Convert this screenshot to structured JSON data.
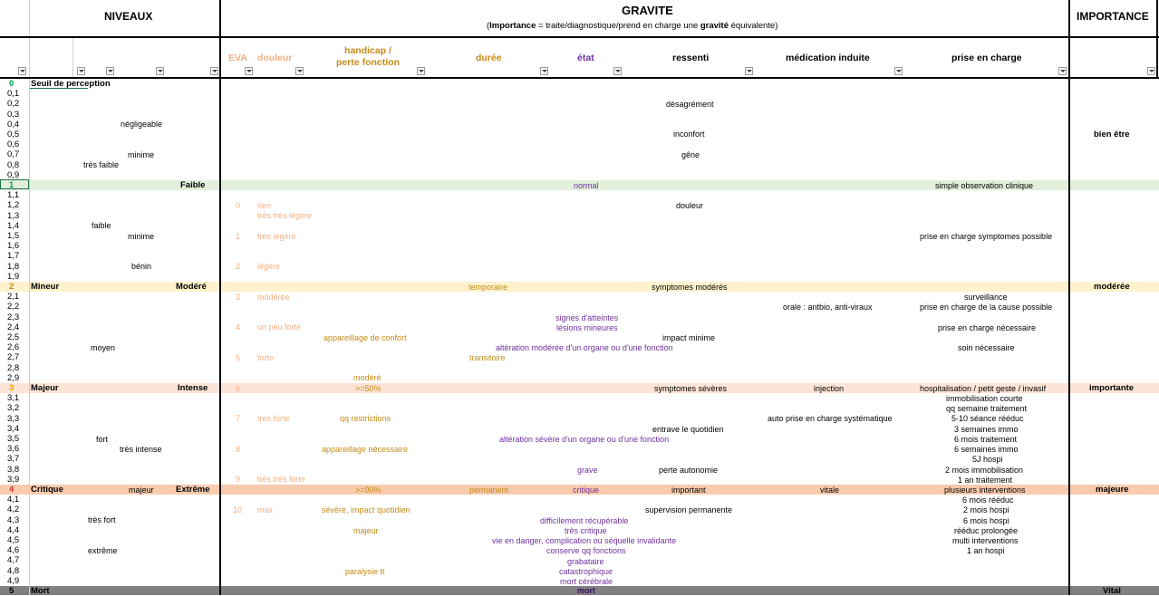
{
  "header": {
    "niveaux": "NIVEAUX",
    "gravite": "GRAVITE",
    "gravite_sub_open": "(",
    "gravite_sub_bold1": "Importance",
    "gravite_sub_mid": " = traite/diagnostique/prend en charge une ",
    "gravite_sub_bold2": "gravité",
    "gravite_sub_end": " équivalente)",
    "importance": "IMPORTANCE"
  },
  "columns": {
    "eva": "EVA",
    "douleur": "douleur",
    "handicap_1": "handicap /",
    "handicap_2": "perte fonction",
    "duree": "durée",
    "etat": "état",
    "ressenti": "ressenti",
    "medication": "médication induite",
    "prise": "prise en charge"
  },
  "colors": {
    "band_green": "#e2efda",
    "band_yellow": "#fff2cc",
    "band_orange": "#fce4d6",
    "band_red": "#f8cbad",
    "band_gray": "#808080",
    "orange": "#f4b183",
    "gold": "#c58b17",
    "purple": "#7030a0"
  },
  "row_labels": [
    "0",
    "0,1",
    "0,2",
    "0,3",
    "0,4",
    "0,5",
    "0,6",
    "0,7",
    "0,8",
    "0,9",
    "1",
    "1,1",
    "1,2",
    "1,3",
    "1,4",
    "1,5",
    "1,6",
    "1,7",
    "1,8",
    "1,9",
    "2",
    "2,1",
    "2,2",
    "2,3",
    "2,4",
    "2,5",
    "2,6",
    "2,7",
    "2,8",
    "2,9",
    "3",
    "3,1",
    "3,2",
    "3,3",
    "3,4",
    "3,5",
    "3,6",
    "3,7",
    "3,8",
    "3,9",
    "4",
    "4,1",
    "4,2",
    "4,3",
    "4,4",
    "4,5",
    "4,6",
    "4,7",
    "4,8",
    "4,9",
    "5"
  ],
  "cells": {
    "seuil": "Seuil de perception",
    "negligeable": "négligeable",
    "minime1": "minime",
    "tres_faible": "très faible",
    "desagrement": "désagrément",
    "inconfort": "inconfort",
    "gene": "gêne",
    "bien_etre": "bien être",
    "faible_lvl": "Faible",
    "normal": "normal",
    "simple_obs": "simple observation clinique",
    "eva0": "0",
    "rien": "rien",
    "tres_tres_legere": "très très légère",
    "douleur_r": "douleur",
    "faible": "faible",
    "eva1": "1",
    "tres_legere": "très légère",
    "minime2": "minime",
    "pec_symptomes": "prise en charge symptomes possible",
    "eva2": "2",
    "legere": "légère",
    "benin": "bénin",
    "mineur": "Mineur",
    "modere_lvl": "Modéré",
    "temporaire": "temporaire",
    "symptomes_moderes": "symptomes modérés",
    "moderee_imp": "modérée",
    "eva3": "3",
    "moderee": "modérée",
    "surveillance": "surveillance",
    "orale": "orale : antbio, anti-viraux",
    "pec_cause": "prise en charge de la cause possible",
    "signes": "signes d'atteintes",
    "eva4": "4",
    "un_peu_forte": "un peu forte",
    "lesions": "lésions mineures",
    "pec_necessaire": "prise en charge nécessaire",
    "appareillage_confort": "appareillage de confort",
    "impact_minime": "impact minime",
    "moyen": "moyen",
    "alteration_moderee": "altération modérée d'un organe ou d'une fonction",
    "soin_necessaire": "soin nécessaire",
    "eva5": "5",
    "forte": "forte",
    "transitoire": "transitoire",
    "modere_h": "modéré",
    "majeur_lvl": "Majeur",
    "intense_lvl": "Intense",
    "eva6": "6",
    "sup50": ">=50%",
    "symptomes_severes": "symptomes sévères",
    "injection": "injection",
    "hospitalisation": "hospitalisation / petit geste / invasif",
    "importante": "importante",
    "immob_courte": "immobilisation courte",
    "qq_semaine": "qq semaine traitement",
    "eva7": "7",
    "tres_forte": "très forte",
    "qq_restrictions": "qq restrictions",
    "auto_pec": "auto prise en charge systématique",
    "seance_reeduc": "5-10 séance rééduc",
    "entrave": "entrave le quotidien",
    "semaines_immo3": "3 semaines immo",
    "fort": "fort",
    "alteration_severe": "altération sévère d'un organe ou d'une fonction",
    "mois_traitement6": "6 mois traitement",
    "tres_intense": "très intense",
    "eva8": "8",
    "appareillage_necessaire": "appareillage nécessaire",
    "semaines_immo6": "6 semaines immo",
    "hospi5j": "5J hospi",
    "grave": "grave",
    "perte_autonomie": "perte autonomie",
    "mois_immob2": "2 mois immobilisation",
    "eva9": "9",
    "tres_tres_forte": "très très forte",
    "an_traitement": "1 an traitement",
    "critique_lvl": "Critique",
    "majeur_sub": "majeur",
    "extreme_lvl": "Extrême",
    "sup90": ">=90%",
    "permanent": "permanent",
    "critique_etat": "critique",
    "important": "important",
    "vitale": "vitale",
    "plusieurs_interventions": "plusieurs interventions",
    "majeure_imp": "majeure",
    "mois_reeduc6": "6 mois rééduc",
    "eva10": "10",
    "max": "max",
    "severe_impact": "sévère, impact quotidien",
    "supervision": "supervision permanente",
    "mois_hospi2": "2 mois hospi",
    "tres_fort": "très fort",
    "difficilement": "difficilement récupérable",
    "mois_hospi6": "6 mois hospi",
    "majeur_h": "majeur",
    "tres_critique": "très critique",
    "reeduc_prolongee": "rééduc  prolongée",
    "vie_en_danger": "vie en danger, complication ou séquelle invalidante",
    "multi_interventions": "multi interventions",
    "extreme": "extrême",
    "conserve": "conserve qq fonctions",
    "an_hospi": "1 an hospi",
    "grabataire": "grabataire",
    "paralysie": "paralysie tt",
    "catastrophique": "catastrophique",
    "mort_cerebrale": "mort cérébrale",
    "mort_lvl": "Mort",
    "mort_etat": "mort",
    "vital_imp": "Vital"
  }
}
